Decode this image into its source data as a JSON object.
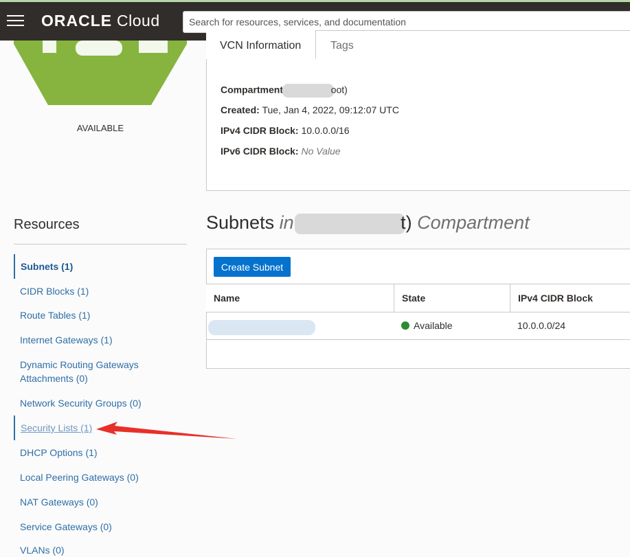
{
  "header": {
    "brand": "ORACLE",
    "product": "Cloud",
    "search_placeholder": "Search for resources, services, and documentation"
  },
  "vcn": {
    "status": "AVAILABLE",
    "hex_color": "#86b43f"
  },
  "tabs": [
    {
      "label": "VCN Information"
    },
    {
      "label": "Tags"
    }
  ],
  "info": {
    "compartment_label": "Compartment:",
    "compartment_value_suffix": "oot)",
    "created_label": "Created:",
    "created_value": "Tue, Jan 4, 2022, 09:12:07 UTC",
    "ipv4_label": "IPv4 CIDR Block:",
    "ipv4_value": "10.0.0.0/16",
    "ipv6_label": "IPv6 CIDR Block:",
    "ipv6_value": "No Value"
  },
  "resources": {
    "title": "Resources",
    "items": [
      {
        "label": "Subnets (1)"
      },
      {
        "label": "CIDR Blocks (1)"
      },
      {
        "label": "Route Tables (1)"
      },
      {
        "label": "Internet Gateways (1)"
      },
      {
        "label": "Dynamic Routing Gateways"
      },
      {
        "label": "Attachments (0)"
      },
      {
        "label": "Network Security Groups (0)"
      },
      {
        "label": "Security Lists (1)"
      },
      {
        "label": "DHCP Options (1)"
      },
      {
        "label": "Local Peering Gateways (0)"
      },
      {
        "label": "NAT Gateways (0)"
      },
      {
        "label": "Service Gateways (0)"
      },
      {
        "label": "VLANs (0)"
      }
    ]
  },
  "subnets": {
    "title": "Subnets",
    "in": "in",
    "suffix": "t)",
    "compartment_word": "Compartment",
    "create_button": "Create Subnet",
    "columns": [
      "Name",
      "State",
      "IPv4 CIDR Block"
    ],
    "rows": [
      {
        "state": "Available",
        "cidr": "10.0.0.0/24",
        "state_color": "#2c8a33"
      }
    ]
  },
  "colors": {
    "topbar": "#312d2a",
    "link": "#2e6ea6",
    "primary_button": "#0572ce",
    "annotation_arrow": "#e8302a"
  }
}
